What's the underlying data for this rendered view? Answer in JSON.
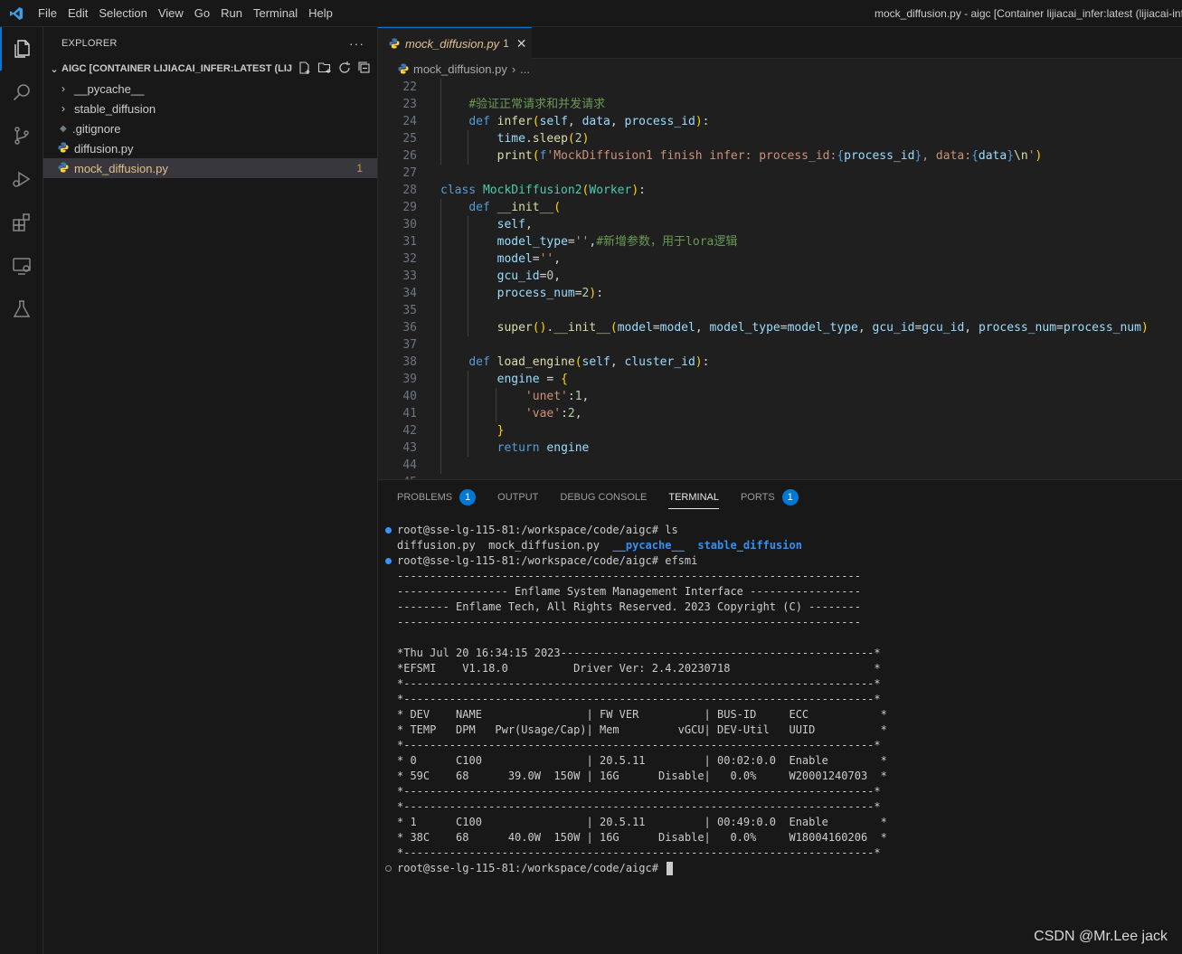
{
  "menu": [
    "File",
    "Edit",
    "Selection",
    "View",
    "Go",
    "Run",
    "Terminal",
    "Help"
  ],
  "window_title": "mock_diffusion.py - aigc [Container lijiacai_infer:latest (lijiacai-infer",
  "explorer": {
    "title": "EXPLORER",
    "root": "AIGC [CONTAINER LIJIACAI_INFER:LATEST (LIJI...",
    "items": [
      {
        "label": "__pycache__",
        "type": "folder"
      },
      {
        "label": "stable_diffusion",
        "type": "folder"
      },
      {
        "label": ".gitignore",
        "type": "file"
      },
      {
        "label": "diffusion.py",
        "type": "python"
      },
      {
        "label": "mock_diffusion.py",
        "type": "python",
        "badge": "1"
      }
    ]
  },
  "tab": {
    "name": "mock_diffusion.py",
    "problems": "1"
  },
  "breadcrumb": {
    "file": "mock_diffusion.py",
    "more": "..."
  },
  "editor": {
    "line_numbers": [
      "22",
      "23",
      "24",
      "25",
      "26",
      "27",
      "28",
      "29",
      "30",
      "31",
      "32",
      "33",
      "34",
      "35",
      "36",
      "37",
      "38",
      "39",
      "40",
      "41",
      "42",
      "43",
      "44",
      "45"
    ]
  },
  "panel": {
    "tabs": [
      {
        "label": "PROBLEMS",
        "badge": "1"
      },
      {
        "label": "OUTPUT"
      },
      {
        "label": "DEBUG CONSOLE"
      },
      {
        "label": "TERMINAL",
        "active": true
      },
      {
        "label": "PORTS",
        "badge": "1"
      }
    ]
  },
  "terminal": {
    "prompt": "root@sse-lg-115-81:/workspace/code/aigc# ",
    "cmd1": "ls",
    "ls_files": "diffusion.py  mock_diffusion.py  ",
    "ls_dir1": "__pycache__",
    "ls_dir2": "stable_diffusion",
    "cmd2": "efsmi",
    "lines": [
      "-----------------------------------------------------------------------",
      "----------------- Enflame System Management Interface -----------------",
      "-------- Enflame Tech, All Rights Reserved. 2023 Copyright (C) --------",
      "-----------------------------------------------------------------------",
      "",
      "*Thu Jul 20 16:34:15 2023------------------------------------------------*",
      "*EFSMI    V1.18.0          Driver Ver: 2.4.20230718                      *",
      "*------------------------------------------------------------------------*",
      "*------------------------------------------------------------------------*",
      "* DEV    NAME                | FW VER          | BUS-ID     ECC           *",
      "* TEMP   DPM   Pwr(Usage/Cap)| Mem         vGCU| DEV-Util   UUID          *",
      "*------------------------------------------------------------------------*",
      "* 0      C100                | 20.5.11         | 00:02:0.0  Enable        *",
      "* 59C    68      39.0W  150W | 16G      Disable|   0.0%     W20001240703  *",
      "*------------------------------------------------------------------------*",
      "*------------------------------------------------------------------------*",
      "* 1      C100                | 20.5.11         | 00:49:0.0  Enable        *",
      "* 38C    68      40.0W  150W | 16G      Disable|   0.0%     W18004160206  *",
      "*------------------------------------------------------------------------*"
    ]
  },
  "watermark": "CSDN @Mr.Lee jack"
}
